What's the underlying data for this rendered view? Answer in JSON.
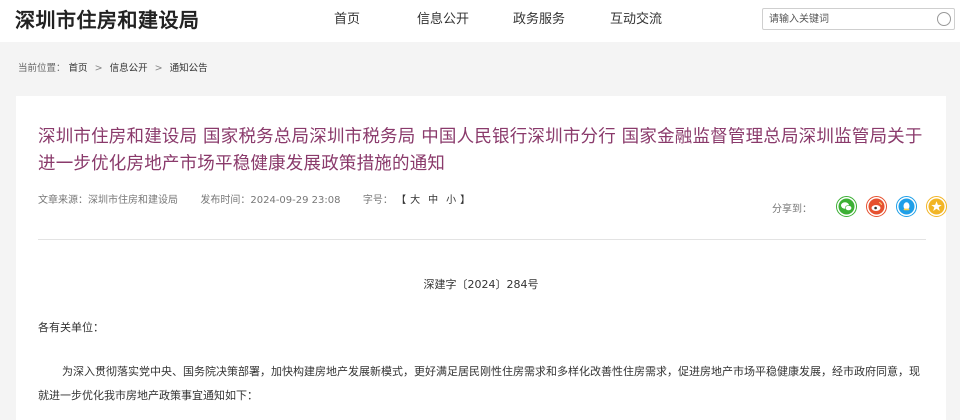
{
  "header": {
    "site_title": "深圳市住房和建设局",
    "nav": [
      "首页",
      "信息公开",
      "政务服务",
      "互动交流"
    ],
    "search": {
      "placeholder": "请输入关键词",
      "value": ""
    }
  },
  "breadcrumb": {
    "prefix": "当前位置：",
    "items": [
      "首页",
      "信息公开",
      "通知公告"
    ],
    "separator": ">"
  },
  "article": {
    "title": "深圳市住房和建设局 国家税务总局深圳市税务局 中国人民银行深圳市分行 国家金融监督管理总局深圳监管局关于进一步优化房地产市场平稳健康发展政策措施的通知",
    "source_label": "文章来源：",
    "source": "深圳市住房和建设局",
    "publish_label": "发布时间：",
    "publish_time": "2024-09-29 23:08",
    "font_size_label": "字号：",
    "font_size_open": "【",
    "font_size_options": [
      "大",
      "中",
      "小"
    ],
    "font_size_close": "】",
    "share_label": "分享到：",
    "share_icons": [
      "wechat-icon",
      "weibo-icon",
      "qq-icon",
      "qzone-icon"
    ],
    "doc_number": "深建字〔2024〕284号",
    "salutation": "各有关单位：",
    "paragraph": "为深入贯彻落实党中央、国务院决策部署，加快构建房地产发展新模式，更好满足居民刚性住房需求和多样化改善性住房需求，促进房地产市场平稳健康发展，经市政府同意，现就进一步优化我市房地产政策事宜通知如下："
  },
  "colors": {
    "title": "#8a3a6b",
    "wechat": "#3cb034",
    "weibo": "#e6512f",
    "qq": "#1e9fe8",
    "qzone": "#f2b526",
    "page_bg": "#f4f4f4"
  }
}
